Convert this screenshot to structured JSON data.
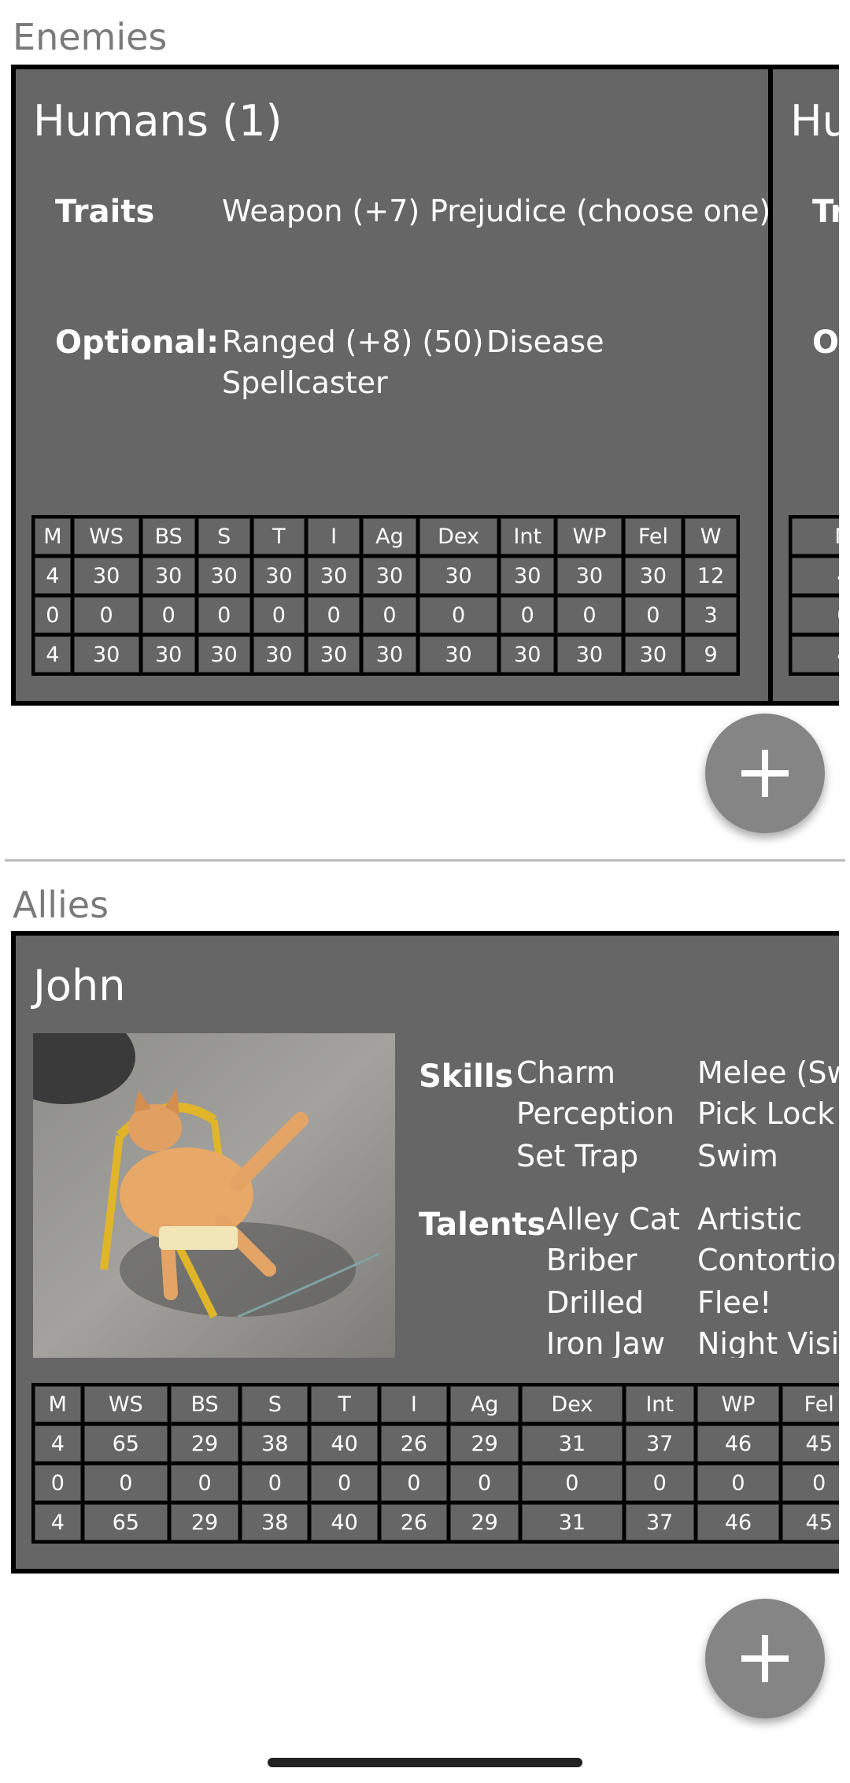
{
  "enemies": {
    "title": "Enemies",
    "cards": [
      {
        "name": "Humans (1)",
        "traits_label": "Traits",
        "traits": [
          "Weapon (+7)",
          "Prejudice (choose one)"
        ],
        "optional_label": "Optional:",
        "optional": [
          "Ranged (+8) (50)",
          "Disease",
          "Spellcaster"
        ],
        "stats": {
          "headers": [
            "M",
            "WS",
            "BS",
            "S",
            "T",
            "I",
            "Ag",
            "Dex",
            "Int",
            "WP",
            "Fel",
            "W"
          ],
          "rows": [
            [
              "4",
              "30",
              "30",
              "30",
              "30",
              "30",
              "30",
              "30",
              "30",
              "30",
              "30",
              "12"
            ],
            [
              "0",
              "0",
              "0",
              "0",
              "0",
              "0",
              "0",
              "0",
              "0",
              "0",
              "0",
              "3"
            ],
            [
              "4",
              "30",
              "30",
              "30",
              "30",
              "30",
              "30",
              "30",
              "30",
              "30",
              "30",
              "9"
            ]
          ]
        }
      },
      {
        "name": "Hu",
        "traits_label": "Tr",
        "optional_label": "O",
        "stats": {
          "header": "M",
          "rows": [
            "4",
            "0",
            "4"
          ]
        }
      }
    ],
    "add_button": "+"
  },
  "allies": {
    "title": "Allies",
    "card": {
      "name": "John",
      "skills_label": "Skills",
      "skills": [
        "Charm",
        "Melee (Sw",
        "Perception",
        "Pick Lock",
        "Set Trap",
        "Swim"
      ],
      "talents_label": "Talents",
      "talents": [
        "Alley Cat",
        "Artistic",
        "Briber",
        "Contortion",
        "Drilled",
        "Flee!",
        "Iron Jaw",
        "Night Visio"
      ],
      "stats": {
        "headers": [
          "M",
          "WS",
          "BS",
          "S",
          "T",
          "I",
          "Ag",
          "Dex",
          "Int",
          "WP",
          "Fel"
        ],
        "rows": [
          [
            "4",
            "65",
            "29",
            "38",
            "40",
            "26",
            "29",
            "31",
            "37",
            "46",
            "45"
          ],
          [
            "0",
            "0",
            "0",
            "0",
            "0",
            "0",
            "0",
            "0",
            "0",
            "0",
            "0"
          ],
          [
            "4",
            "65",
            "29",
            "38",
            "40",
            "26",
            "29",
            "31",
            "37",
            "46",
            "45"
          ]
        ]
      }
    },
    "add_button": "+"
  },
  "icons": {
    "add": "plus-icon",
    "portrait": "cat-photo"
  },
  "colors": {
    "card_bg": "#666666",
    "border": "#000000",
    "fab": "#858585",
    "section_title": "#7a7a7a"
  }
}
